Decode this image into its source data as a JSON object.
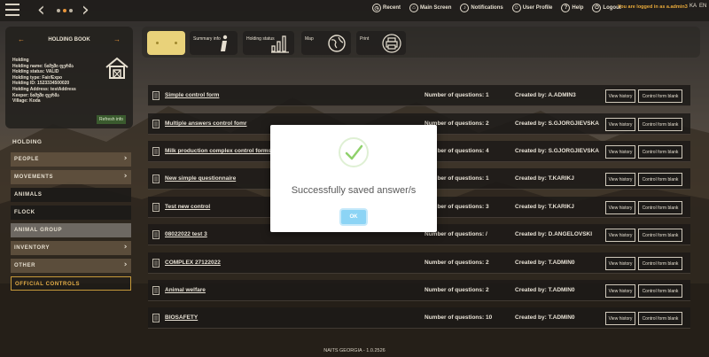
{
  "topbar": {
    "links": [
      {
        "label": "Recent",
        "icon": "clock-icon"
      },
      {
        "label": "Main Screen",
        "icon": "home-icon"
      },
      {
        "label": "Notifications",
        "icon": "bell-icon"
      },
      {
        "label": "User Profile",
        "icon": "user-icon"
      },
      {
        "label": "Help",
        "icon": "question-icon"
      },
      {
        "label": "Logout",
        "icon": "power-icon"
      }
    ],
    "logged_in": "You are logged in as a.admin3",
    "lang_ka": "KA",
    "lang_en": "EN"
  },
  "holding_book": {
    "title": "HOLDING BOOK",
    "lines": [
      "Holding",
      "Holding name: ნიმუში ფერმა",
      "Holding status: VALID",
      "Holding type: Fair/Expo",
      "Holding ID: 1523334500020",
      "Holding Address: testAddress",
      "Keeper: ნიმუში ფერმა",
      "Village: Kodа"
    ],
    "refresh_label": "Refresh info"
  },
  "sidebar": {
    "section_title": "HOLDING",
    "items": [
      {
        "label": "PEOPLE",
        "style": "brown",
        "chevron": true
      },
      {
        "label": "MOVEMENTS",
        "style": "brown",
        "chevron": true
      },
      {
        "label": "ANIMALS",
        "style": "dark",
        "chevron": false
      },
      {
        "label": "FLOCK",
        "style": "dark",
        "chevron": false
      },
      {
        "label": "ANIMAL GROUP",
        "style": "grey",
        "chevron": false
      },
      {
        "label": "INVENTORY",
        "style": "brown",
        "chevron": true
      },
      {
        "label": "OTHER",
        "style": "brown",
        "chevron": true
      },
      {
        "label": "OFFICIAL CONTROLS",
        "style": "outlined",
        "chevron": false
      }
    ]
  },
  "toolbar": {
    "summary_label": "Summary info",
    "holding_status_label": "Holding status",
    "map_label": "Map",
    "print_label": "Print"
  },
  "forms": [
    {
      "name": "Simple control form",
      "questions": "Number of questions: 1",
      "created_by": "Created by: A.ADMIN3"
    },
    {
      "name": "Multiple answers control fomr",
      "questions": "Number of questions: 2",
      "created_by": "Created by: S.GJORGJIEVSKA"
    },
    {
      "name": "Milk production complex control forms",
      "questions": "Number of questions: 4",
      "created_by": "Created by: S.GJORGJIEVSKA"
    },
    {
      "name": "New simple questionnaire",
      "questions": "Number of questions: 1",
      "created_by": "Created by: T.KARIKJ"
    },
    {
      "name": "Test new control",
      "questions": "Number of questions: 3",
      "created_by": "Created by: T.KARIKJ"
    },
    {
      "name": "08022022 test 3",
      "questions": "Number of questions: /",
      "created_by": "Created by: D.ANGELOVSKI"
    },
    {
      "name": "COMPLEX 27122022",
      "questions": "Number of questions: 2",
      "created_by": "Created by: T.ADMIN0"
    },
    {
      "name": "Animal welfare",
      "questions": "Number of questions: 2",
      "created_by": "Created by: T.ADMIN0"
    },
    {
      "name": "BIOSAFETY",
      "questions": "Number of questions: 10",
      "created_by": "Created by: T.ADMIN0"
    }
  ],
  "form_buttons": {
    "view_history": "View history",
    "control_form_blank": "Control form blank"
  },
  "footer": "NAITS GEORGIA - 1.0.2526",
  "modal": {
    "message": "Successfully saved answer/s",
    "ok_label": "OK"
  },
  "colors": {
    "accent": "#e8953a",
    "modal_ok": "#8cd4f5",
    "check": "#8fd16b"
  }
}
